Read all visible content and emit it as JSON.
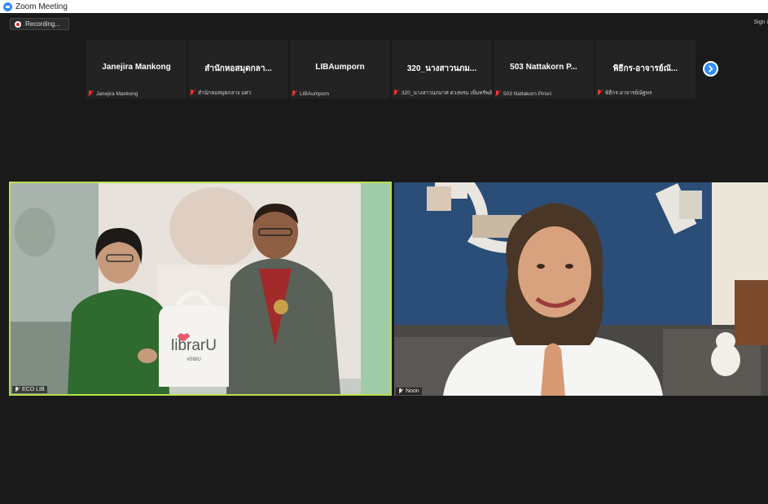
{
  "window": {
    "title": "Zoom Meeting"
  },
  "toolbar": {
    "recording_label": "Recording...",
    "signin_label": "Sign i"
  },
  "participants": [
    {
      "name": "Janejira Mankong",
      "label": "Janejira Mankong"
    },
    {
      "name": "สำนักหอสมุดกลา...",
      "label": "สำนักหอสมุดกลาง มศว"
    },
    {
      "name": "LIBAumporn",
      "label": "LIBAumporn"
    },
    {
      "name": "320_นางสาวนภม...",
      "label": "320_นางสาวนภมาศ ดวงพรม เพิ่มทรัพย์"
    },
    {
      "name": "503 Nattakorn P...",
      "label": "503 Nattakorn Pinsri"
    },
    {
      "name": "พิธีกร-อาจารย์ณั...",
      "label": "พิธีกร-อาจารย์ณัฐพร"
    }
  ],
  "videos": {
    "left": {
      "label": "ECO LIB",
      "bag_text": "librarU",
      "bag_sub": "#SWU"
    },
    "right": {
      "label": "Noon"
    }
  },
  "colors": {
    "active_speaker_border": "#b6e04d",
    "zoom_blue": "#2d8cff",
    "muted_red": "#e33333",
    "background": "#1a1a1a"
  }
}
